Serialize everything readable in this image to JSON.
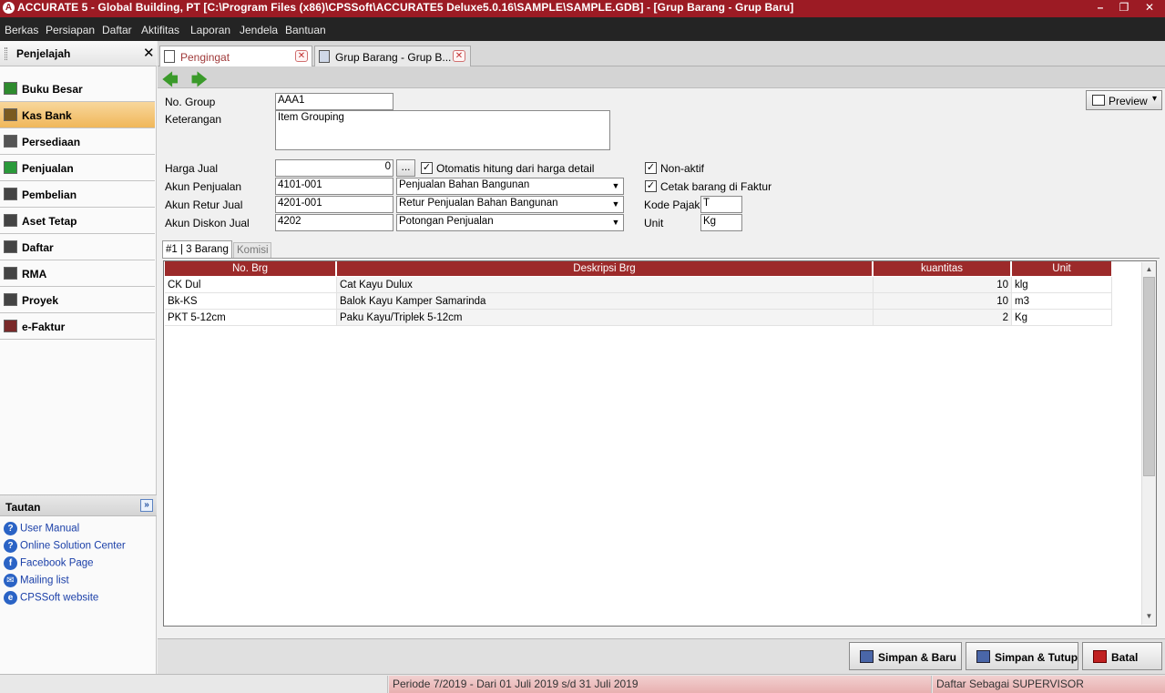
{
  "window": {
    "title": "ACCURATE 5  - Global Building, PT   [C:\\Program Files (x86)\\CPSSoft\\ACCURATE5 Deluxe5.0.16\\SAMPLE\\SAMPLE.GDB] - [Grup Barang - Grup Baru]",
    "minimize": "–",
    "restore": "❐",
    "close": "✕"
  },
  "menu": [
    "Berkas",
    "Persiapan",
    "Daftar",
    "Aktifitas",
    "Laporan",
    "Jendela",
    "Bantuan"
  ],
  "explorer": {
    "title": "Penjelajah",
    "close": "✕",
    "items": [
      {
        "label": "Buku Besar",
        "icon": "ledger-icon",
        "color": "#2e8b2e"
      },
      {
        "label": "Kas Bank",
        "icon": "cash-bank-icon",
        "color": "#7a5a20"
      },
      {
        "label": "Persediaan",
        "icon": "inventory-icon",
        "color": "#555555"
      },
      {
        "label": "Penjualan",
        "icon": "sales-icon",
        "color": "#2a9a3a"
      },
      {
        "label": "Pembelian",
        "icon": "cart-icon",
        "color": "#444444"
      },
      {
        "label": "Aset Tetap",
        "icon": "house-icon",
        "color": "#444444"
      },
      {
        "label": "Daftar",
        "icon": "list-icon",
        "color": "#444444"
      },
      {
        "label": "RMA",
        "icon": "rma-icon",
        "color": "#444444"
      },
      {
        "label": "Proyek",
        "icon": "project-icon",
        "color": "#444444"
      },
      {
        "label": "e-Faktur",
        "icon": "efaktur-icon",
        "color": "#7a2a2a"
      }
    ],
    "selected": "Kas Bank"
  },
  "tautan": {
    "title": "Tautan",
    "collapse": "»",
    "links": [
      {
        "label": "User Manual",
        "icon": "help-icon",
        "glyph": "?"
      },
      {
        "label": "Online Solution Center",
        "icon": "help-icon",
        "glyph": "?"
      },
      {
        "label": "Facebook Page",
        "icon": "facebook-icon",
        "glyph": "f"
      },
      {
        "label": "Mailing list",
        "icon": "mailing-icon",
        "glyph": "✉"
      },
      {
        "label": "CPSSoft website",
        "icon": "web-icon",
        "glyph": "e"
      }
    ]
  },
  "tabs": [
    {
      "label": "Pengingat",
      "close": "✕"
    },
    {
      "label": "Grup Barang - Grup B...",
      "close": "✕"
    }
  ],
  "toolbar": {
    "back": "🡄",
    "forward": "🡆",
    "preview_label": "Preview",
    "preview_dd": "▾"
  },
  "form": {
    "no_group_label": "No. Group",
    "no_group_value": "AAA1",
    "keterangan_label": "Keterangan",
    "keterangan_value": "Item Grouping",
    "harga_jual_label": "Harga Jual",
    "harga_jual_value": "0",
    "ellipsis": "...",
    "otomatis_label": "Otomatis hitung dari harga detail",
    "otomatis_checked": "✓",
    "akun_penjualan_label": "Akun Penjualan",
    "akun_penjualan_code": "4101-001",
    "akun_penjualan_name": "Penjualan Bahan Bangunan",
    "akun_retur_label": "Akun Retur Jual",
    "akun_retur_code": "4201-001",
    "akun_retur_name": "Retur Penjualan Bahan Bangunan",
    "akun_diskon_label": "Akun Diskon Jual",
    "akun_diskon_code": "4202",
    "akun_diskon_name": "Potongan Penjualan",
    "non_aktif_label": "Non-aktif",
    "non_aktif_checked": "✓",
    "cetak_label": "Cetak barang di Faktur",
    "cetak_checked": "✓",
    "kode_pajak_label": "Kode Pajak",
    "kode_pajak_value": "T",
    "unit_label": "Unit",
    "unit_value": "Kg",
    "dd": "▼"
  },
  "subtabs": [
    "#1 | 3 Barang",
    "Komisi"
  ],
  "grid": {
    "columns": [
      "No. Brg",
      "Deskripsi Brg",
      "kuantitas",
      "Unit"
    ],
    "rows": [
      {
        "no": "CK Dul",
        "desc": "Cat Kayu Dulux",
        "qty": "10",
        "unit": "klg"
      },
      {
        "no": "Bk-KS",
        "desc": "Balok Kayu Kamper Samarinda",
        "qty": "10",
        "unit": "m3"
      },
      {
        "no": "PKT 5-12cm",
        "desc": "Paku Kayu/Triplek 5-12cm",
        "qty": "2",
        "unit": "Kg"
      }
    ],
    "scroll_up": "▲",
    "scroll_down": "▼"
  },
  "buttons": {
    "simpan_baru": "Simpan & Baru",
    "simpan_tutup": "Simpan & Tutup",
    "batal": "Batal"
  },
  "status": {
    "periode": "Periode 7/2019 - Dari 01 Juli 2019 s/d 31 Juli 2019",
    "user": "Daftar Sebagai SUPERVISOR"
  }
}
